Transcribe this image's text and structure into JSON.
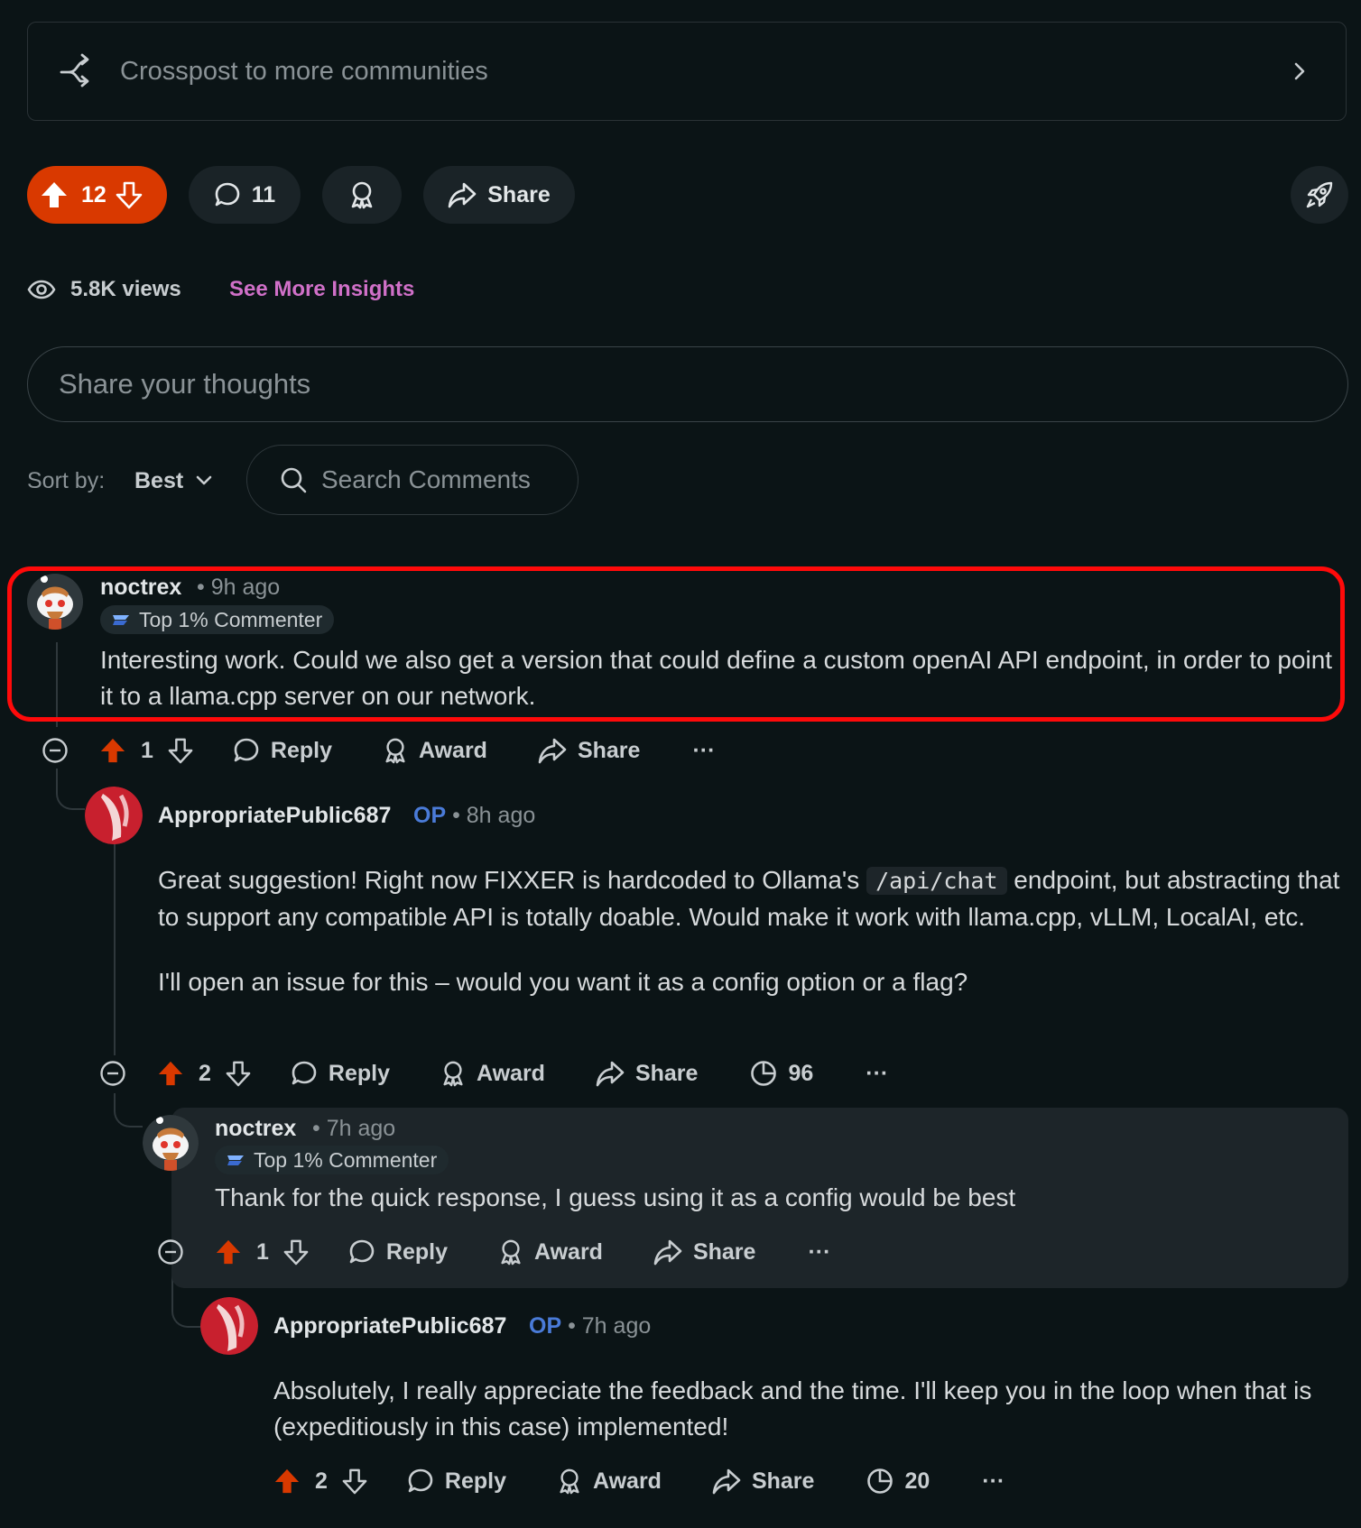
{
  "crosspost": {
    "label": "Crosspost to more communities"
  },
  "post_actions": {
    "score": "12",
    "comments": "11",
    "share": "Share"
  },
  "insights": {
    "views": "5.8K views",
    "link": "See More Insights"
  },
  "composer": {
    "placeholder": "Share your thoughts"
  },
  "sort": {
    "label": "Sort by:",
    "value": "Best",
    "search_placeholder": "Search Comments"
  },
  "comments": [
    {
      "author": "noctrex",
      "time": "9h ago",
      "flair": "Top 1% Commenter",
      "body": "Interesting work. Could we also get a version that could define a custom openAI API endpoint, in order to point it to a llama.cpp server on our network.",
      "score": "1",
      "reply": "Reply",
      "award": "Award",
      "share": "Share",
      "more": "···"
    },
    {
      "author": "AppropriatePublic687",
      "op": "OP",
      "time": "8h ago",
      "body_1a": "Great suggestion! Right now FIXXER is hardcoded to Ollama's ",
      "body_1code": "/api/chat",
      "body_1b": " endpoint, but abstracting that to support any compatible API is totally doable. Would make it work with llama.cpp, vLLM, LocalAI, etc.",
      "body_2": "I'll open an issue for this – would you want it as a config option or a flag?",
      "score": "2",
      "reply": "Reply",
      "award": "Award",
      "share": "Share",
      "views": "96",
      "more": "···"
    },
    {
      "author": "noctrex",
      "time": "7h ago",
      "flair": "Top 1% Commenter",
      "body": "Thank for the quick response, I guess using it as a config would be best",
      "score": "1",
      "reply": "Reply",
      "award": "Award",
      "share": "Share",
      "more": "···"
    },
    {
      "author": "AppropriatePublic687",
      "op": "OP",
      "time": "7h ago",
      "body": "Absolutely, I really appreciate the feedback and the time. I'll keep you in the loop when that is (expeditiously in this case) implemented!",
      "score": "2",
      "reply": "Reply",
      "award": "Award",
      "share": "Share",
      "views": "20",
      "more": "···"
    }
  ],
  "colors": {
    "background": "#0b1416",
    "upvote": "#d93900",
    "op": "#4a7bd8",
    "insights": "#d070c8",
    "highlight": "#ff0a0a"
  }
}
